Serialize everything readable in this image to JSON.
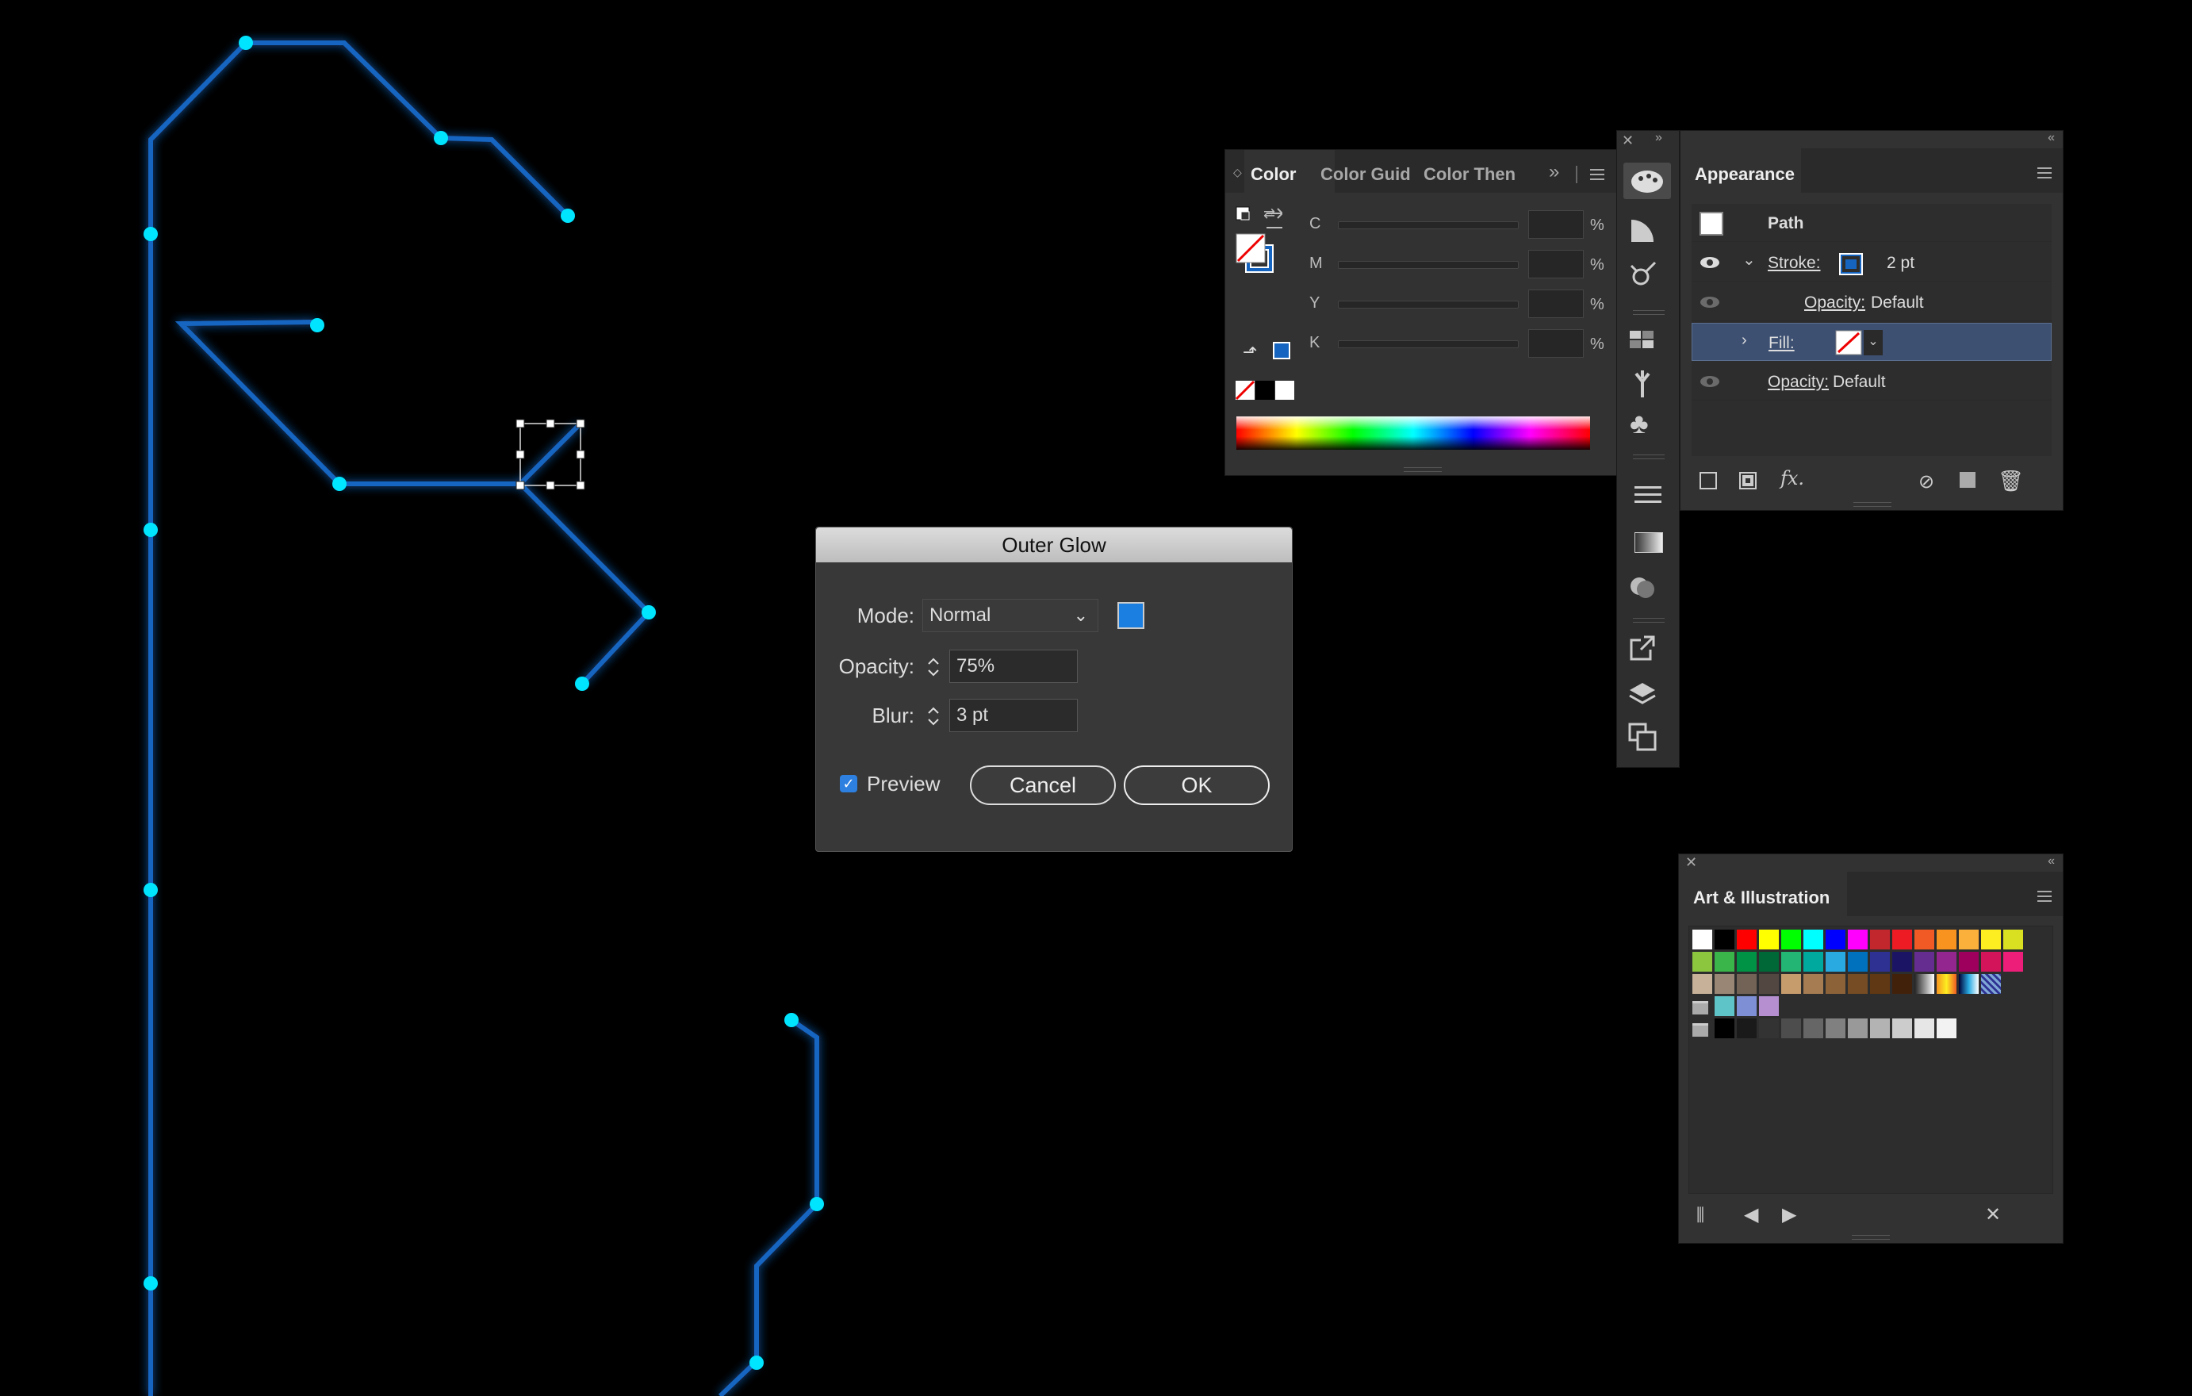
{
  "color_panel": {
    "tabs": [
      "Color",
      "Color Guid",
      "Color Then"
    ],
    "channels": [
      "C",
      "M",
      "Y",
      "K"
    ],
    "pct": "%"
  },
  "appearance_panel": {
    "tab": "Appearance",
    "object": "Path",
    "stroke_label": "Stroke:",
    "stroke_weight": "2 pt",
    "stroke_opacity_label": "Opacity:",
    "stroke_opacity_value": "Default",
    "fill_label": "Fill:",
    "opacity_label": "Opacity:",
    "opacity_value": "Default",
    "fx_label": "fx."
  },
  "swatches_panel": {
    "tab": "Art & Illustration"
  },
  "dialog": {
    "title": "Outer Glow",
    "mode_label": "Mode:",
    "mode_value": "Normal",
    "opacity_label": "Opacity:",
    "opacity_value": "75%",
    "blur_label": "Blur:",
    "blur_value": "3 pt",
    "preview_label": "Preview",
    "cancel_label": "Cancel",
    "ok_label": "OK",
    "glow_color": "#1a7fe0"
  },
  "colors": {
    "stroke_blue": "#1565c0",
    "anchor_cyan": "#00e5ff",
    "selection_row": "#3d5072"
  }
}
